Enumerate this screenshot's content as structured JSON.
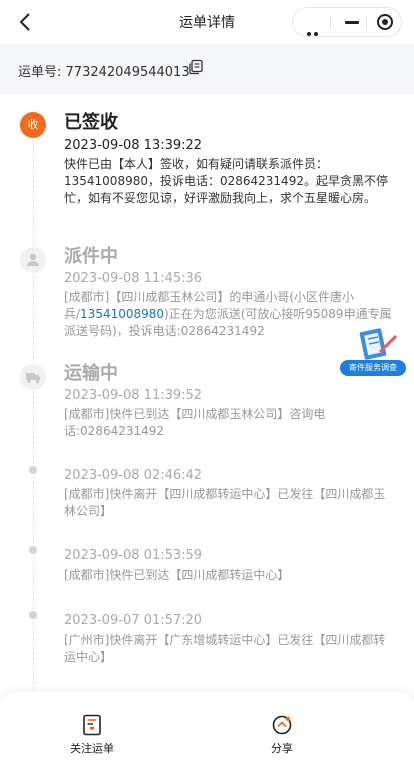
{
  "header": {
    "title": "运单详情"
  },
  "waybill": {
    "label": "运单号:",
    "number": "773242049544013"
  },
  "timeline": {
    "signed": {
      "badge": "收",
      "status": "已签收",
      "time": "2023-09-08 13:39:22",
      "desc": "快件已由【本人】签收，如有疑问请联系派件员：13541008980，投诉电话：02864231492。起早贪黑不停忙，如有不妥您见谅，好评激励我向上，求个五星暖心房。"
    },
    "delivering": {
      "status": "派件中",
      "time": "2023-09-08 11:45:36",
      "desc_before": "[成都市]【四川成都玉林公司】的申通小哥(小区件唐小兵/",
      "phone": "13541008980",
      "desc_after": ")正在为您派送(可放心接听95089申通专属派送号码)，投诉电话:02864231492"
    },
    "transit": {
      "status": "运输中",
      "time": "2023-09-08 11:39:52",
      "desc": "[成都市]快件已到达【四川成都玉林公司】咨询电话:02864231492"
    },
    "events": [
      {
        "time": "2023-09-08 02:46:42",
        "desc": "[成都市]快件离开【四川成都转运中心】已发往【四川成都玉林公司】"
      },
      {
        "time": "2023-09-08 01:53:59",
        "desc": "[成都市]快件已到达【四川成都转运中心】"
      },
      {
        "time": "2023-09-07 01:57:20",
        "desc": "[广州市]快件离开【广东增城转运中心】已发往【四川成都转运中心】"
      }
    ]
  },
  "float_badge": {
    "label": "寄件服务调查"
  },
  "bottom_bar": {
    "follow_label": "关注运单",
    "share_label": "分享"
  },
  "colors": {
    "accent": "#f26a1b",
    "link": "#1a73c8",
    "float": "#1f7fe0"
  }
}
